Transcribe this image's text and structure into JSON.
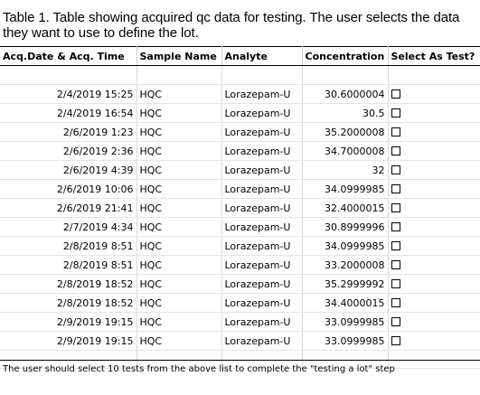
{
  "caption": "Table 1. Table showing acquired qc data for testing. The user selects the data they want to use to define the lot.",
  "table": {
    "headers": {
      "date": "Acq.Date & Acq. Time",
      "sample": "Sample Name",
      "analyte": "Analyte",
      "concentration": "Concentration",
      "select": "Select As Test?"
    },
    "rows": [
      {
        "date": "2/4/2019 15:25",
        "sample": "HQC",
        "analyte": "Lorazepam-U",
        "concentration": "30.6000004",
        "selected": false
      },
      {
        "date": "2/4/2019 16:54",
        "sample": "HQC",
        "analyte": "Lorazepam-U",
        "concentration": "30.5",
        "selected": false
      },
      {
        "date": "2/6/2019 1:23",
        "sample": "HQC",
        "analyte": "Lorazepam-U",
        "concentration": "35.2000008",
        "selected": false
      },
      {
        "date": "2/6/2019 2:36",
        "sample": "HQC",
        "analyte": "Lorazepam-U",
        "concentration": "34.7000008",
        "selected": false
      },
      {
        "date": "2/6/2019 4:39",
        "sample": "HQC",
        "analyte": "Lorazepam-U",
        "concentration": "32",
        "selected": false
      },
      {
        "date": "2/6/2019 10:06",
        "sample": "HQC",
        "analyte": "Lorazepam-U",
        "concentration": "34.0999985",
        "selected": false
      },
      {
        "date": "2/6/2019 21:41",
        "sample": "HQC",
        "analyte": "Lorazepam-U",
        "concentration": "32.4000015",
        "selected": false
      },
      {
        "date": "2/7/2019 4:34",
        "sample": "HQC",
        "analyte": "Lorazepam-U",
        "concentration": "30.8999996",
        "selected": false
      },
      {
        "date": "2/8/2019 8:51",
        "sample": "HQC",
        "analyte": "Lorazepam-U",
        "concentration": "34.0999985",
        "selected": false
      },
      {
        "date": "2/8/2019 8:51",
        "sample": "HQC",
        "analyte": "Lorazepam-U",
        "concentration": "33.2000008",
        "selected": false
      },
      {
        "date": "2/8/2019 18:52",
        "sample": "HQC",
        "analyte": "Lorazepam-U",
        "concentration": "35.2999992",
        "selected": false
      },
      {
        "date": "2/8/2019 18:52",
        "sample": "HQC",
        "analyte": "Lorazepam-U",
        "concentration": "34.4000015",
        "selected": false
      },
      {
        "date": "2/9/2019 19:15",
        "sample": "HQC",
        "analyte": "Lorazepam-U",
        "concentration": "33.0999985",
        "selected": false
      },
      {
        "date": "2/9/2019 19:15",
        "sample": "HQC",
        "analyte": "Lorazepam-U",
        "concentration": "33.0999985",
        "selected": false
      }
    ]
  },
  "footer_note": "The user should select 10 tests from the above list to complete the \"testing a lot\" step"
}
